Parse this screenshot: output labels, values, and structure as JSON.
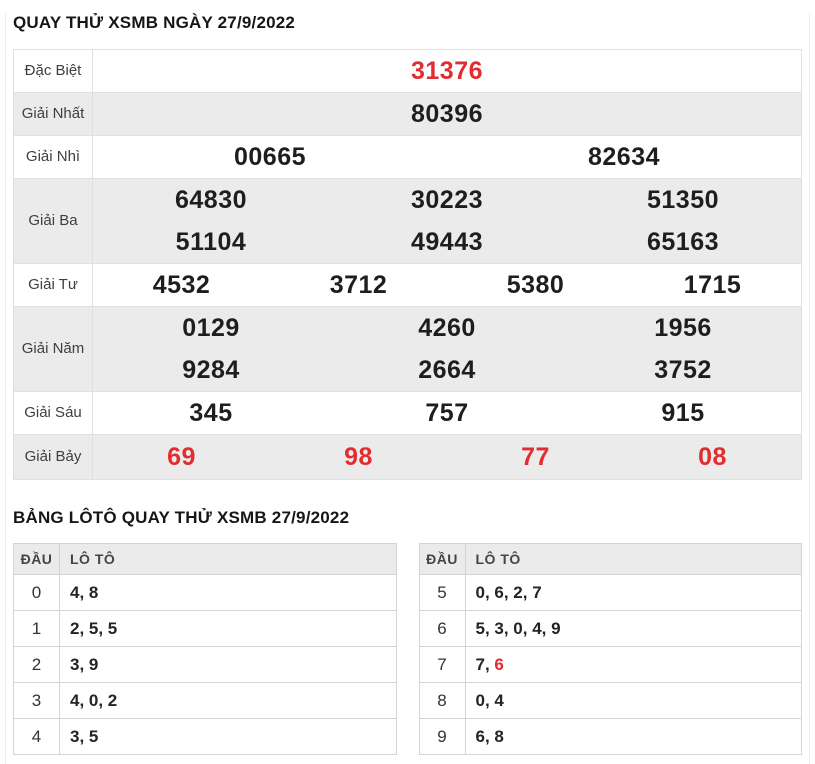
{
  "colors": {
    "accent_red": "#e12d30",
    "number_text": "#1e1e1e",
    "label_text": "#3f3f3f",
    "row_alt_bg": "#ebebeb",
    "table_border": "#e0e0e0",
    "loto_border": "#d4d4d4",
    "loto_header_bg": "#ebebeb"
  },
  "header": {
    "title": "QUAY THỬ XSMB NGÀY 27/9/2022"
  },
  "prize_table": {
    "rows": [
      {
        "label": "Đặc Biệt",
        "lines": [
          [
            "31376"
          ]
        ]
      },
      {
        "label": "Giải Nhất",
        "lines": [
          [
            "80396"
          ]
        ]
      },
      {
        "label": "Giải Nhì",
        "lines": [
          [
            "00665",
            "82634"
          ]
        ]
      },
      {
        "label": "Giải Ba",
        "lines": [
          [
            "64830",
            "30223",
            "51350"
          ],
          [
            "51104",
            "49443",
            "65163"
          ]
        ]
      },
      {
        "label": "Giải Tư",
        "lines": [
          [
            "4532",
            "3712",
            "5380",
            "1715"
          ]
        ]
      },
      {
        "label": "Giải Năm",
        "lines": [
          [
            "0129",
            "4260",
            "1956"
          ],
          [
            "9284",
            "2664",
            "3752"
          ]
        ]
      },
      {
        "label": "Giải Sáu",
        "lines": [
          [
            "345",
            "757",
            "915"
          ]
        ]
      },
      {
        "label": "Giải Bảy",
        "lines": [
          [
            "69",
            "98",
            "77",
            "08"
          ]
        ]
      }
    ]
  },
  "loto_section": {
    "title": "BẢNG LÔTÔ QUAY THỬ XSMB 27/9/2022",
    "col_head": "ĐẦU",
    "col_loto": "LÔ TÔ",
    "left_rows": [
      {
        "head": "0",
        "value": "4, 8"
      },
      {
        "head": "1",
        "value": "2, 5, 5"
      },
      {
        "head": "2",
        "value": "3, 9"
      },
      {
        "head": "3",
        "value": "4, 0, 2"
      },
      {
        "head": "4",
        "value": "3, 5"
      }
    ],
    "right_rows": [
      {
        "head": "5",
        "value": "0, 6, 2, 7"
      },
      {
        "head": "6",
        "value": "5, 3, 0, 4, 9"
      },
      {
        "head": "7",
        "value_black": "7, ",
        "value_red": "6"
      },
      {
        "head": "8",
        "value": "0, 4"
      },
      {
        "head": "9",
        "value": "6, 8"
      }
    ]
  }
}
